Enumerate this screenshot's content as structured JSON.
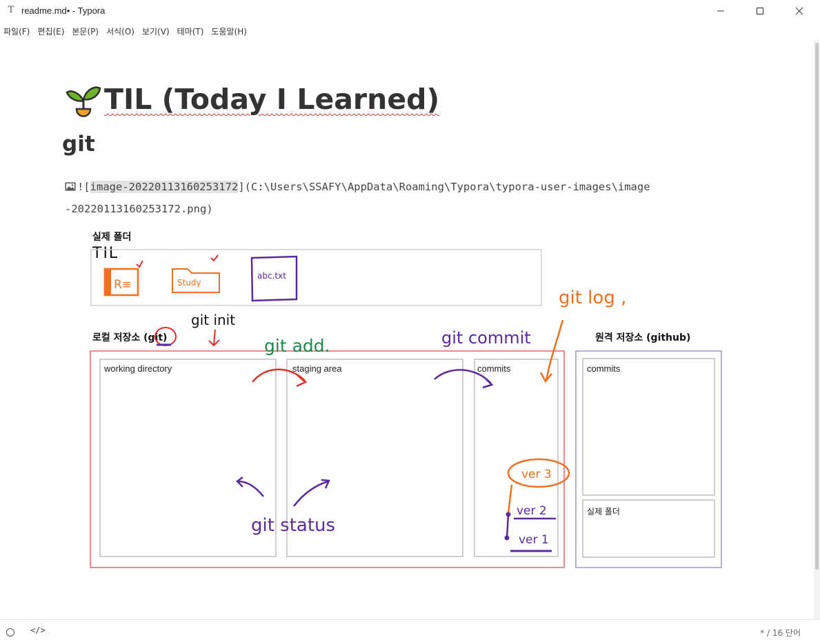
{
  "window": {
    "title": "readme.md• - Typora",
    "icon_letter": "T",
    "controls": [
      "minimize-icon",
      "maximize-icon",
      "close-icon"
    ]
  },
  "menu": [
    "파일(F)",
    "편집(E)",
    "본문(P)",
    "서식(O)",
    "보기(V)",
    "테마(T)",
    "도움말(H)"
  ],
  "document": {
    "h1": "TIL (Today I Learned)",
    "h1_icon": "seedling-emoji",
    "h2": "git",
    "image_markdown": {
      "prefix": "![",
      "alt": "image-20220113160253172",
      "mid": "](",
      "path_line1": "C:\\Users\\SSAFY\\AppData\\Roaming\\Typora\\typora-user-images\\image",
      "path_line2": "-20220113160253172.png",
      "suffix": ")"
    }
  },
  "diagram": {
    "real_folder_label": "실제 폴더",
    "real_folder_handwriting": "TIL",
    "file_icons": [
      "R≡",
      "Study",
      "abc.txt"
    ],
    "local_repo_label": "로컬 저장소 (git)",
    "remote_repo_label": "원격 저장소 (github)",
    "panels": {
      "working": "working directory",
      "staging": "staging area",
      "commits": "commits",
      "remote_commits": "commits",
      "remote_real_folder": "실제 폴더"
    },
    "annotations": {
      "git_init": "git init",
      "git_add": "git add.",
      "git_commit": "git commit",
      "git_log": "git log ,",
      "git_status": "git status",
      "ver3": "ver 3",
      "ver2": "ver 2",
      "ver1": "ver 1"
    },
    "colors": {
      "local_border": "#e06666",
      "remote_border": "#9a9ac8",
      "black_ink": "#111111",
      "green_ink": "#1b8a4a",
      "purple_ink": "#5b2a9e",
      "orange_ink": "#f07020",
      "red_ink": "#e0302a"
    }
  },
  "status": {
    "source_mode_icon": "code-icon",
    "word_count": "* / 16 단어"
  }
}
